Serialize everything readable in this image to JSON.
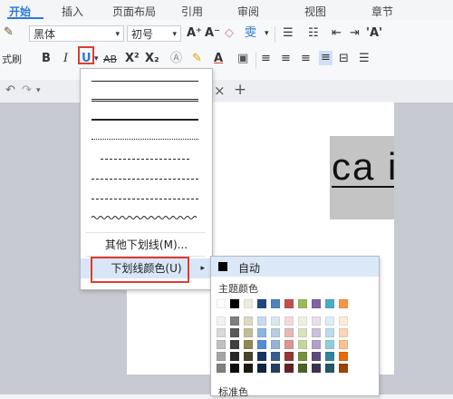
{
  "tabs": [
    "开始",
    "插入",
    "页面布局",
    "引用",
    "审阅",
    "视图",
    "章节"
  ],
  "ribbon": {
    "painter_label": "式刷",
    "font_name": "黑体",
    "font_size": "初号",
    "grow_font": "A⁺",
    "shrink_font": "A⁻",
    "clear_format": "◇",
    "phonetic": "雯",
    "bold": "B",
    "italic": "I",
    "underline": "U",
    "strikethrough": "AB",
    "superscript": "X²",
    "subscript": "X₂",
    "font_color_letter": "A",
    "more_label": "'A'"
  },
  "qa": {
    "undo": "↶",
    "redo": "↷"
  },
  "doc_strip": {
    "close": "×",
    "new_tab": "+"
  },
  "document": {
    "text": "ca i"
  },
  "underline_menu": {
    "other_label": "其他下划线(M)...",
    "color_label": "下划线颜色(U)",
    "submenu_arrow": "▸"
  },
  "palette": {
    "auto_label": "自动",
    "theme_label": "主题颜色",
    "standard_label": "标准色",
    "theme_top": [
      "#ffffff",
      "#000000",
      "#eeece1",
      "#1f497d",
      "#4f81bd",
      "#c0504d",
      "#9bbb59",
      "#8064a2",
      "#4bacc6",
      "#f79646"
    ],
    "theme_shades": [
      [
        "#f2f2f2",
        "#7f7f7f",
        "#ddd9c3",
        "#c6d9f0",
        "#dbe5f1",
        "#f2dcdb",
        "#ebf1dd",
        "#e5e0ec",
        "#dbeef3",
        "#fdeada"
      ],
      [
        "#d8d8d8",
        "#595959",
        "#c4bd97",
        "#8db3e2",
        "#b8cce4",
        "#e5b9b7",
        "#d7e3bc",
        "#ccc1d9",
        "#b7dde8",
        "#fbd5b5"
      ],
      [
        "#bfbfbf",
        "#3f3f3f",
        "#938953",
        "#548dd4",
        "#95b3d7",
        "#d99694",
        "#c3d69b",
        "#b2a2c7",
        "#92cddc",
        "#fac08f"
      ],
      [
        "#a5a5a5",
        "#262626",
        "#494429",
        "#17365d",
        "#366092",
        "#953734",
        "#76923c",
        "#5f497a",
        "#31859b",
        "#e36c09"
      ],
      [
        "#7f7f7f",
        "#0c0c0c",
        "#1d1b10",
        "#0f243e",
        "#244061",
        "#632423",
        "#4f6128",
        "#3f3151",
        "#205867",
        "#974806"
      ]
    ]
  }
}
